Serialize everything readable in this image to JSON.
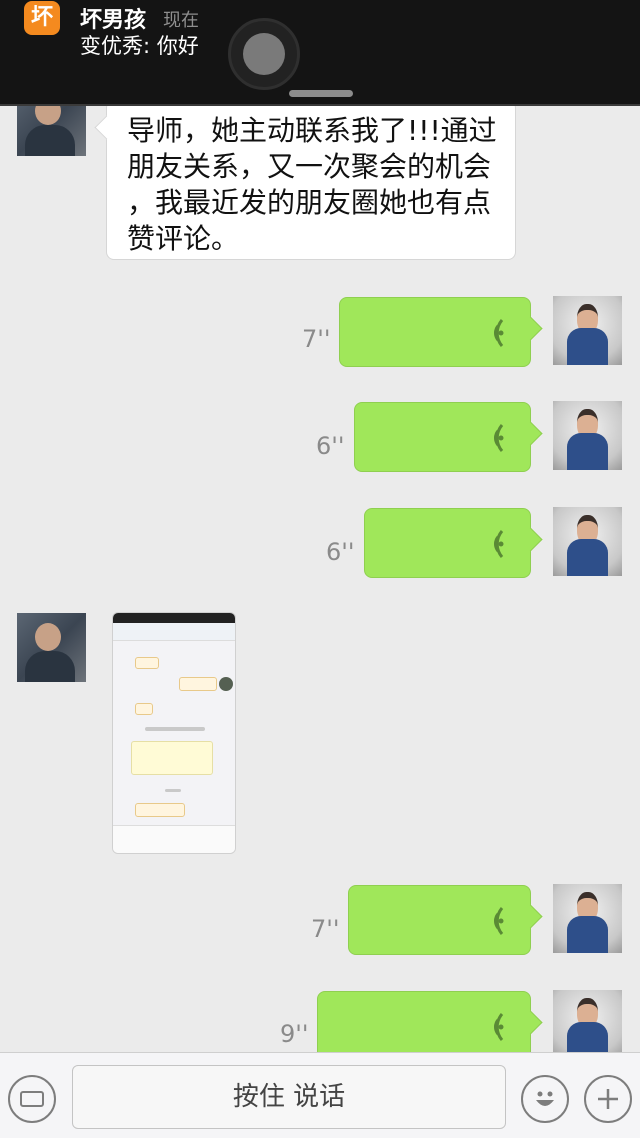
{
  "notification": {
    "app_icon_text": "坏",
    "sender": "坏男孩",
    "time": "现在",
    "preview": "变优秀: 你好"
  },
  "chat": {
    "text_message": {
      "lines": [
        "导师，她主动联系我了!!!通过",
        "朋友关系，又一次聚会的机会",
        "，我最近发的朋友圈她也有点",
        "赞评论。"
      ]
    },
    "voice_messages": [
      {
        "duration": "7''"
      },
      {
        "duration": "6''"
      },
      {
        "duration": "6''"
      },
      {
        "duration": "7''"
      },
      {
        "duration": "9''"
      }
    ]
  },
  "input_bar": {
    "talk_label": "按住 说话",
    "keyboard_icon": "keyboard-icon",
    "emoji_icon": "emoji-icon",
    "plus_icon": "plus-icon"
  },
  "colors": {
    "voice_bubble": "#a0e75a",
    "banner_bg": "#141414",
    "app_icon": "#f48a1f",
    "chat_bg": "#ebebeb"
  }
}
